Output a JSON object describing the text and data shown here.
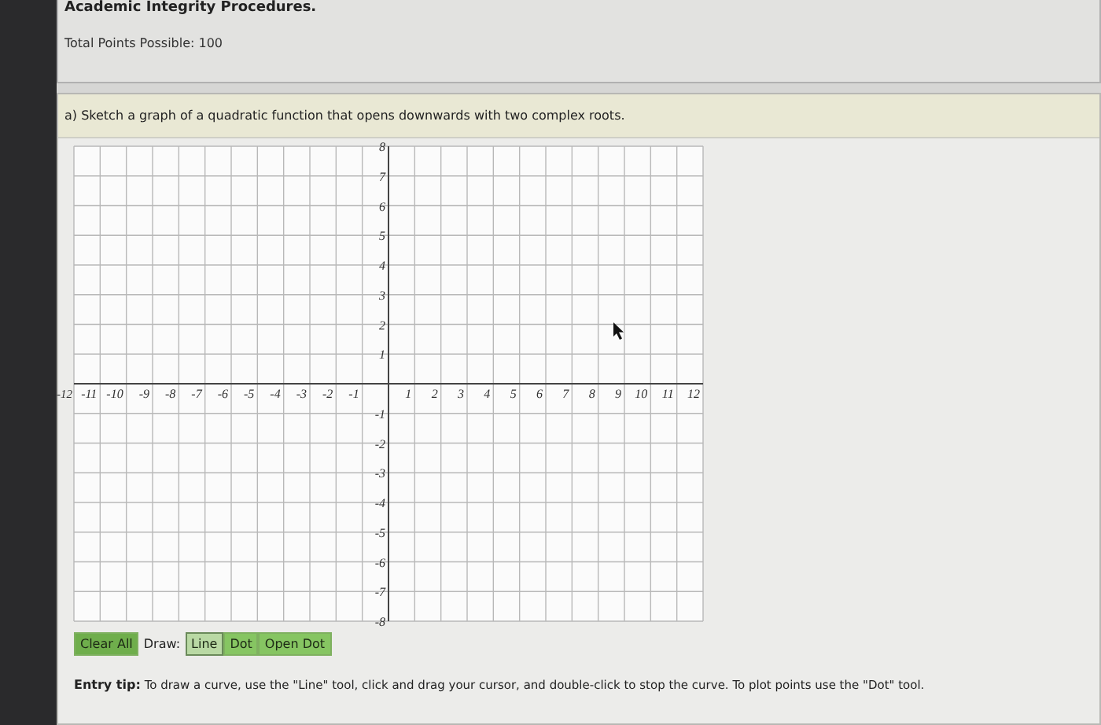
{
  "header": {
    "title": "Academic Integrity Procedures.",
    "points": "Total Points Possible: 100"
  },
  "question": {
    "prompt": "a) Sketch a graph of a quadratic function that opens downwards with two complex roots."
  },
  "graph": {
    "x_labels": [
      "-12",
      "-11",
      "-10",
      "-9",
      "-8",
      "-7",
      "-6",
      "-5",
      "-4",
      "-3",
      "-2",
      "-1",
      "1",
      "2",
      "3",
      "4",
      "5",
      "6",
      "7",
      "8",
      "9",
      "10",
      "11",
      "12"
    ],
    "y_labels": [
      "8",
      "7",
      "6",
      "5",
      "4",
      "3",
      "2",
      "1",
      "-1",
      "-2",
      "-3",
      "-4",
      "-5",
      "-6",
      "-7",
      "-8"
    ]
  },
  "toolbar": {
    "clear": "Clear All",
    "draw_label": "Draw:",
    "tools": [
      {
        "label": "Line",
        "selected": true
      },
      {
        "label": "Dot",
        "selected": false
      },
      {
        "label": "Open Dot",
        "selected": false
      }
    ]
  },
  "entry_tip": {
    "label": "Entry tip:",
    "text": "To draw a curve, use the \"Line\" tool, click and drag your cursor, and double-click to stop the curve. To plot points use the \"Dot\" tool."
  }
}
